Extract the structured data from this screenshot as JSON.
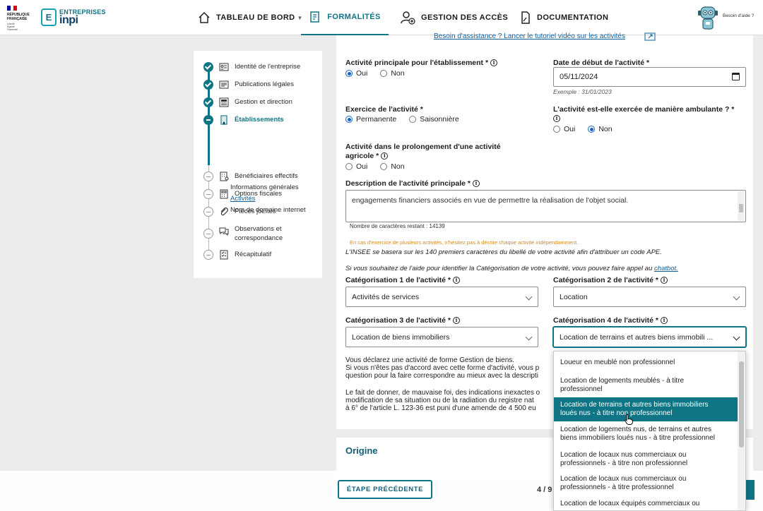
{
  "header": {
    "rf": {
      "line1": "RÉPUBLIQUE",
      "line2": "FRANÇAISE",
      "motto": [
        "Liberté",
        "Égalité",
        "Fraternité"
      ]
    },
    "brand": {
      "badge": "E",
      "entreprises": "ENTREPRISES",
      "name": "inpi"
    },
    "nav": [
      {
        "label": "TABLEAU DE BORD",
        "icon": "home-icon"
      },
      {
        "label": "FORMALITÉS",
        "icon": "form-document-icon"
      },
      {
        "label": "GESTION DES ACCÈS",
        "icon": "user-add-icon"
      },
      {
        "label": "DOCUMENTATION",
        "icon": "document-icon"
      }
    ],
    "help_label": "Besoin d'aide ?"
  },
  "steps": {
    "items": [
      {
        "label": "Identité de l'entreprise",
        "state": "done",
        "icon": "id-card-icon"
      },
      {
        "label": "Publications légales",
        "state": "done",
        "icon": "newspaper-icon"
      },
      {
        "label": "Gestion et direction",
        "state": "done",
        "icon": "org-chart-icon"
      },
      {
        "label": "Établissements",
        "state": "current",
        "icon": "building-icon"
      },
      {
        "label": "Bénéficiaires effectifs",
        "state": "todo",
        "icon": "building-people-icon"
      },
      {
        "label": "Options fiscales",
        "state": "todo",
        "icon": "calculator-icon"
      },
      {
        "label": "Pièces jointes",
        "state": "todo",
        "icon": "paperclip-icon"
      },
      {
        "label": "Observations et",
        "label2": "correspondance",
        "state": "todo",
        "icon": "chat-icon"
      },
      {
        "label": "Récapitulatif",
        "state": "todo",
        "icon": "checklist-icon"
      }
    ],
    "sub_items": [
      "Informations générales",
      "Activités",
      "Nom de domaine internet"
    ]
  },
  "form": {
    "assist_link": "Besoin d'assistance ? Lancer le tutoriel vidéo sur les activités",
    "main_activity": {
      "label": "Activité principale pour l'établissement *",
      "options": [
        "Oui",
        "Non"
      ],
      "selected": "Oui"
    },
    "start_date": {
      "label": "Date de début de l'activité *",
      "value": "05/11/2024",
      "hint": "Exemple : 31/01/2023"
    },
    "exercise": {
      "label": "Exercice de l'activité *",
      "options": [
        "Permanente",
        "Saisonnière"
      ],
      "selected": "Permanente"
    },
    "ambulant": {
      "label": "L'activité est-elle exercée de manière ambulante ? *",
      "options": [
        "Oui",
        "Non"
      ],
      "selected": "Non"
    },
    "agricole": {
      "label1": "Activité dans le prolongement d'une activité",
      "label2": "agricole *",
      "options": [
        "Oui",
        "Non"
      ],
      "selected": ""
    },
    "description": {
      "label": "Description de l'activité principale *",
      "value": "engagements financiers associés en vue de permettre la réalisation de l'objet social.",
      "counter": "Nombre de caractères restant : 14139"
    },
    "note_orange": "En cas d'exercice de plusieurs activités, n'hésitez pas à décrire chaque activité indépendamment.",
    "note_insee": "L'INSEE se basera sur les 140 premiers caractères du libellé de votre activité afin d'attribuer un code APE.",
    "note_chatbot": "Si vous souhaitez de l'aide pour identifier la Catégorisation de votre activité, vous pouvez faire appel au",
    "chatbot_link": "chatbot.",
    "cat1": {
      "label": "Catégorisation 1 de l'activité *",
      "value": "Activités de services"
    },
    "cat2": {
      "label": "Catégorisation 2 de l'activité *",
      "value": "Location"
    },
    "cat3": {
      "label": "Catégorisation 3 de l'activité *",
      "value": "Location de biens immobiliers"
    },
    "cat4": {
      "label": "Catégorisation 4 de l'activité *",
      "value": "Location de terrains et autres biens immobili ..."
    },
    "info_para": [
      "Vous déclarez une activité de forme Gestion de biens.",
      "Si vous n'êtes pas d'accord avec cette forme d'activité, vous p",
      "question pour la faire correspondre au mieux avec la descripti"
    ],
    "warning_para": [
      "Le fait de donner, de mauvaise foi, des indications inexactes o",
      "modification de sa situation ou de la radiation du registre nat",
      "à 6° de l'article L. 123-36 est puni d'une amende de 4 500 eu"
    ]
  },
  "dropdown": {
    "options": [
      "Loueur en meublé non professionnel",
      "Location de logements meublés - à titre|professionnel",
      "Location de terrains et autres biens immobiliers|loués nus - à titre non professionnel",
      "Location de logements nus, de terrains et autres|biens immobiliers loués nus - à titre professionnel",
      "Location de locaux nus commerciaux ou|professionnels - à titre non professionnel",
      "Location de locaux nus commerciaux ou|professionnels - à titre professionnel",
      "Location de locaux équipés commerciaux ou"
    ],
    "selected_index": 2
  },
  "origin": {
    "title": "Origine"
  },
  "footer": {
    "prev_label": "ÉTAPE PRÉCÉDENTE",
    "page_count": "4 / 9"
  },
  "colors": {
    "primary": "#0f7584",
    "link": "#0f5f9a",
    "radio": "#1665c0",
    "warning": "#d08a20"
  }
}
